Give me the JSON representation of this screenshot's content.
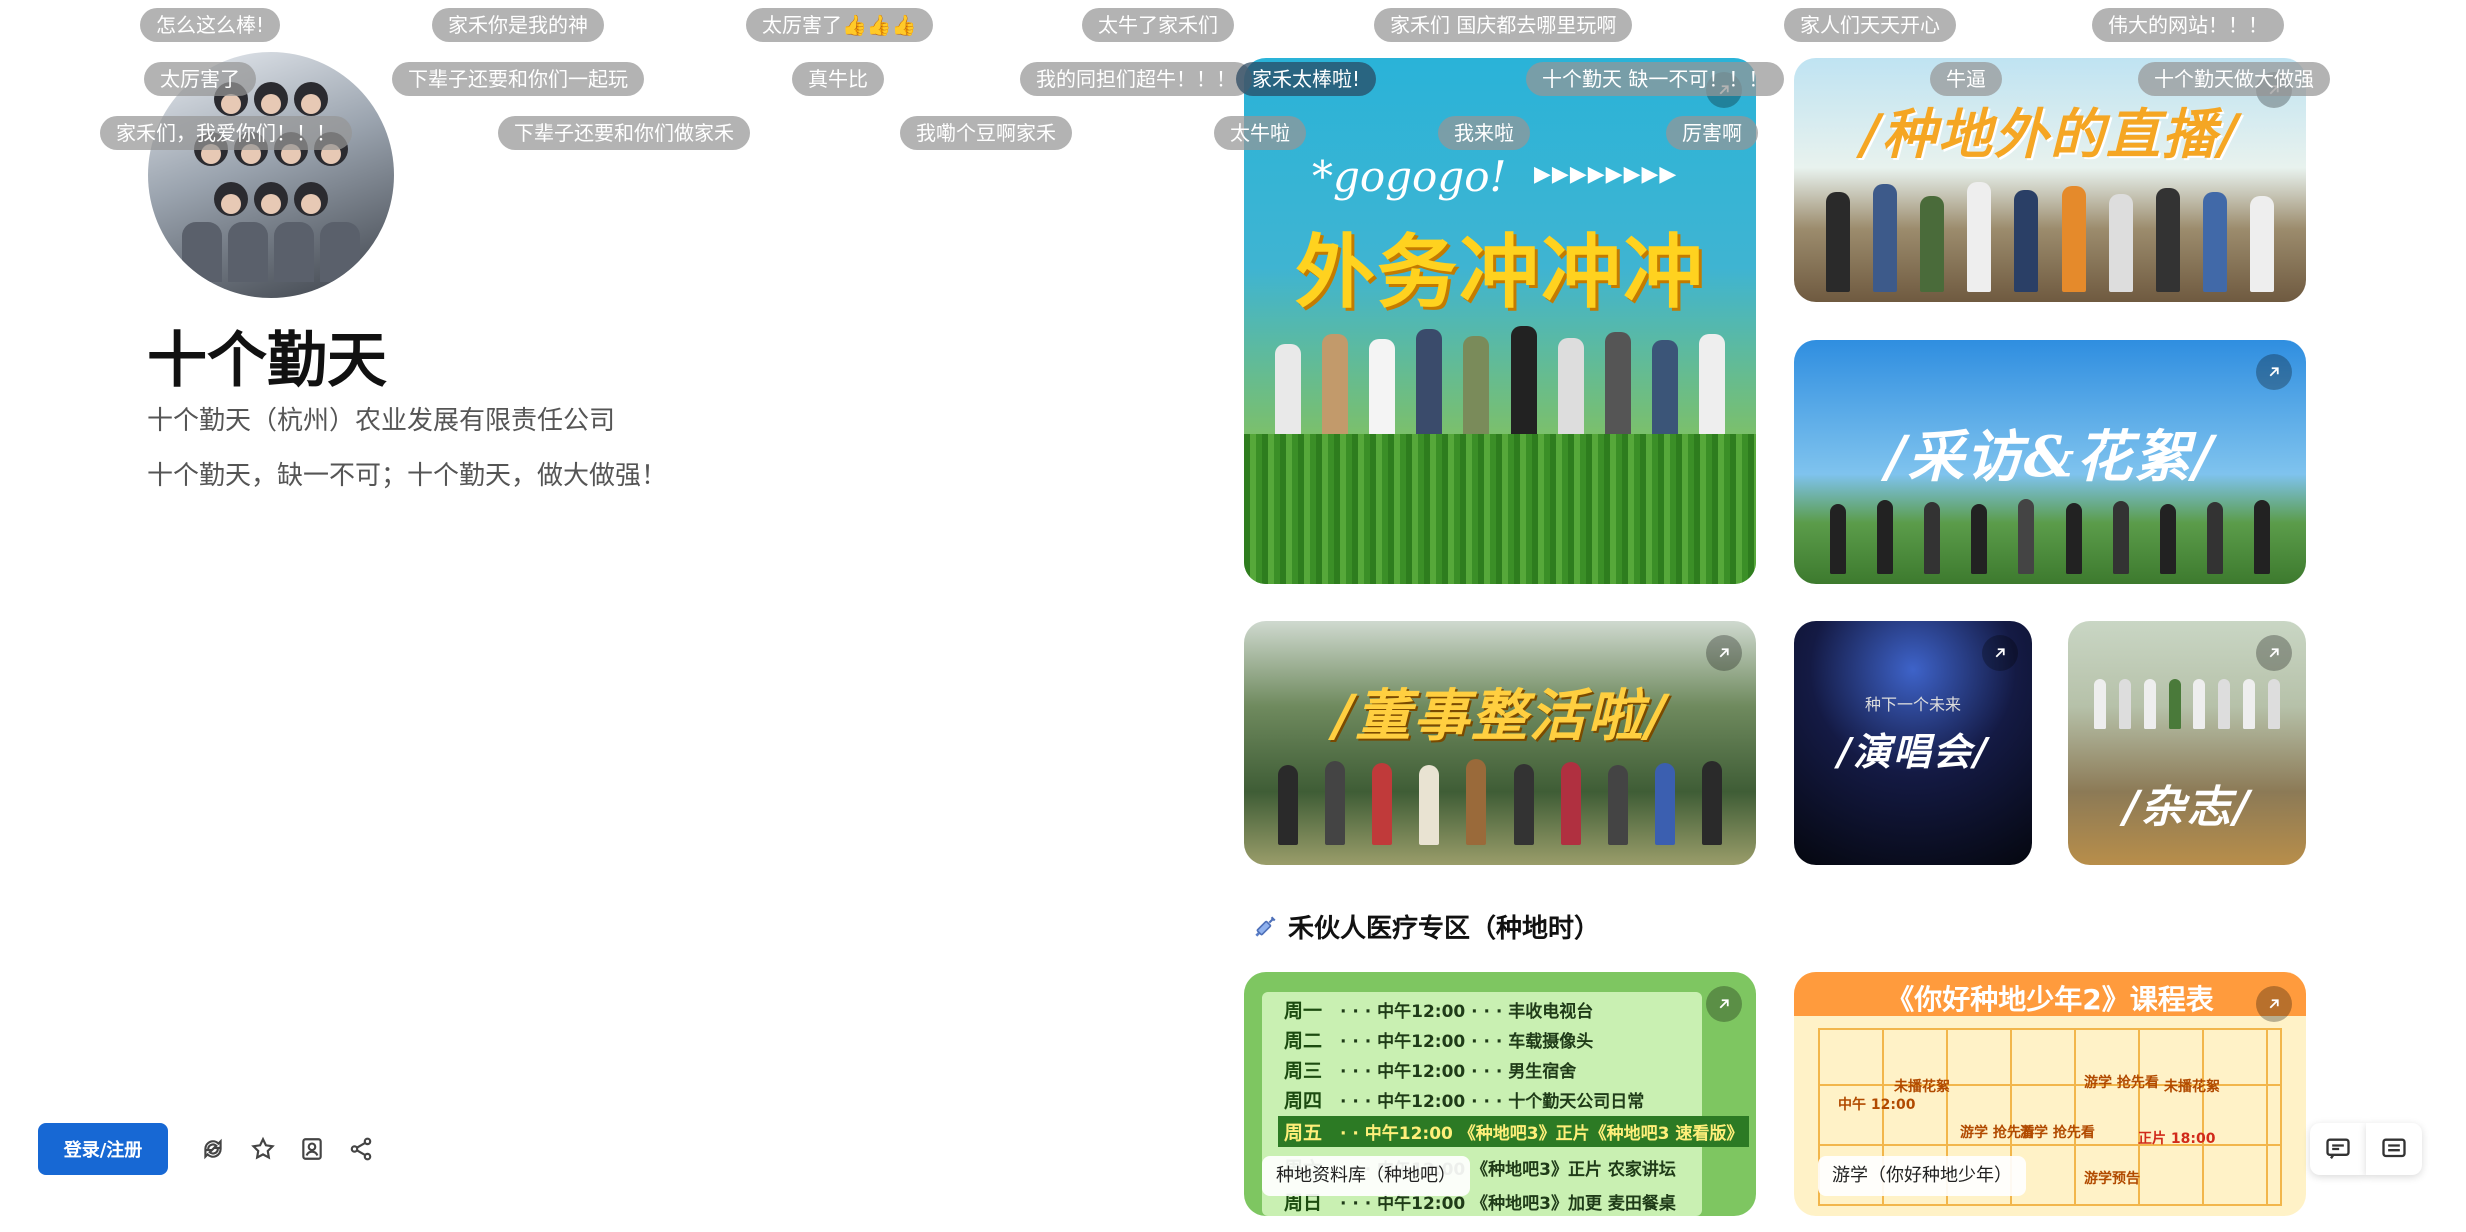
{
  "profile": {
    "title": "十个勤天",
    "company": "十个勤天（杭州）农业发展有限责任公司",
    "motto": "十个勤天，缺一不可；十个勤天，做大做强！"
  },
  "toolbar": {
    "login_label": "登录/注册",
    "icons": [
      "recycle-icon",
      "star-icon",
      "bookmark-icon",
      "share-icon"
    ]
  },
  "danmaku": [
    "怎么这么棒!",
    "家禾你是我的神",
    "太厉害了👍👍👍",
    "太牛了家禾们",
    "家禾们 国庆都去哪里玩啊",
    "家人们天天开心",
    "伟大的网站！！！",
    "太厉害了",
    "下辈子还要和你们一起玩",
    "真牛比",
    "我的同担们超牛！！！",
    "家禾太棒啦!",
    "十个勤天 缺一不可！！！",
    "牛逼",
    "十个勤天做大做强",
    "家禾们，我爱你们！！！",
    "下辈子还要和你们做家禾",
    "我嘞个豆啊家禾",
    "太牛啦",
    "我来啦",
    "厉害啊"
  ],
  "cards": {
    "c1": {
      "gogo": "*gogogo!",
      "arrows": "▶▶▶▶▶▶▶▶",
      "caption": "外务冲冲冲"
    },
    "c2": {
      "caption": "/种地外的直播/"
    },
    "c3": {
      "caption": "/采访&花絮/"
    },
    "c4": {
      "caption": "/董事整活啦/"
    },
    "c5": {
      "sub": "种下一个未来",
      "caption": "/演唱会/"
    },
    "c6": {
      "caption": "/杂志/"
    }
  },
  "section": {
    "title": "禾伙人医疗专区（种地时）"
  },
  "schedule": {
    "rows": [
      {
        "day": "周一",
        "text": "· · · 中午12:00 · · · 丰收电视台"
      },
      {
        "day": "周二",
        "text": "· · · 中午12:00 · · · 车载摄像头"
      },
      {
        "day": "周三",
        "text": "· · · 中午12:00 · · · 男生宿舍"
      },
      {
        "day": "周四",
        "text": "· · · 中午12:00 · · · 十个勤天公司日常"
      },
      {
        "day": "周五",
        "text": "· · 中午12:00 《种地吧3》正片《种地吧3 速看版》"
      },
      {
        "day": "周六",
        "text": "· · · 中午12:00 《种地吧3》正片 农家讲坛"
      },
      {
        "day": "周日",
        "text": "· · · 中午12:00 《种地吧3》加更 麦田餐桌"
      }
    ],
    "label": "种地资料库（种地吧）"
  },
  "timetable": {
    "header": "《你好种地少年2》课程表",
    "cells": [
      "中午 12:00",
      "未播花絮",
      "游学 抢先看",
      "游学 抢先看",
      "游学 抢先看",
      "未播花絮",
      "正片 18:00",
      "游学预告"
    ],
    "label": "游学（你好种地少年）"
  },
  "colors": {
    "accent": "#1768d4"
  }
}
